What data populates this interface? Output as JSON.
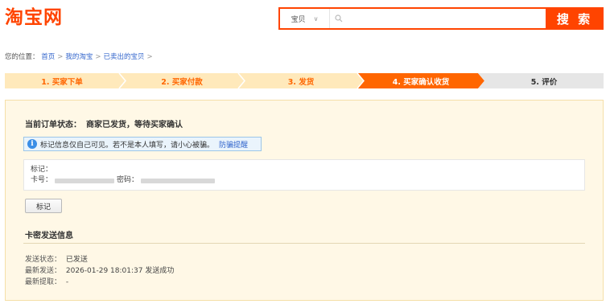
{
  "header": {
    "logo": "淘宝网",
    "search": {
      "category": "宝贝",
      "value": "",
      "placeholder": "",
      "button_label": "搜 索"
    }
  },
  "breadcrumb": {
    "prefix": "您的位置：",
    "items": [
      "首页",
      "我的淘宝",
      "已卖出的宝贝"
    ]
  },
  "steps": [
    {
      "label": "1. 买家下单",
      "state": "done"
    },
    {
      "label": "2. 买家付款",
      "state": "done"
    },
    {
      "label": "3. 发货",
      "state": "done"
    },
    {
      "label": "4. 买家确认收货",
      "state": "current"
    },
    {
      "label": "5. 评价",
      "state": "todo"
    }
  ],
  "order": {
    "status_label": "当前订单状态：",
    "status_value": "商家已发货，等待买家确认"
  },
  "notice": {
    "text": "标记信息仅自己可见。若不是本人填写，请小心被骗。",
    "link": "防骗提醒"
  },
  "mark": {
    "label_mark": "标记：",
    "label_card": "卡号：",
    "label_password": "密码：",
    "button": "标记"
  },
  "delivery": {
    "title": "卡密发送信息",
    "rows": [
      {
        "key": "发送状态：",
        "value": "已发送"
      },
      {
        "key": "最新发送：",
        "value": "2026-01-29 18:01:37 发送成功"
      },
      {
        "key": "最新提取：",
        "value": "-"
      }
    ]
  },
  "colors": {
    "brand": "#ff4400",
    "step_done_bg": "#ffe9bb",
    "step_current_bg": "#ff6600",
    "step_todo_bg": "#e6e6e6",
    "panel_bg": "#fff8e6",
    "link": "#3366cc"
  }
}
